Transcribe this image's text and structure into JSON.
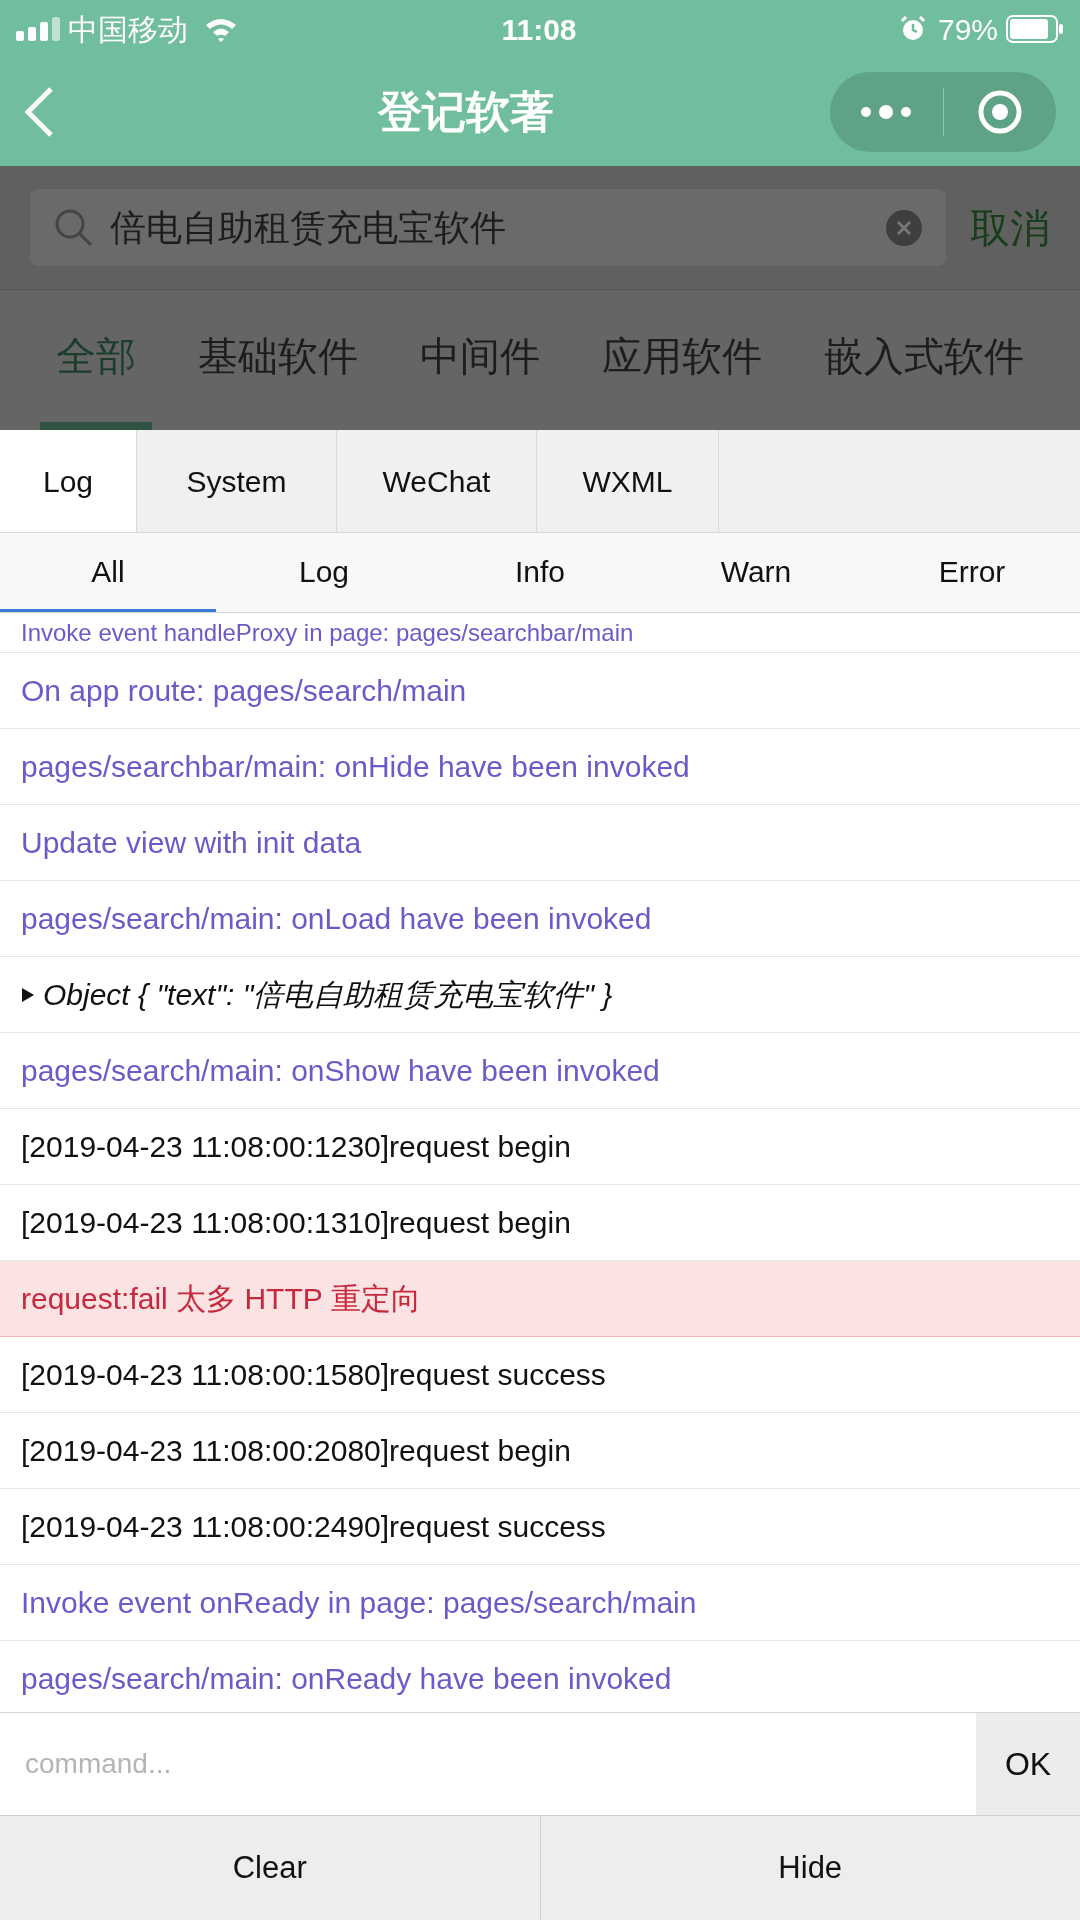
{
  "status_bar": {
    "carrier": "中国移动",
    "time": "11:08",
    "battery": "79%"
  },
  "nav_bar": {
    "title": "登记软著"
  },
  "search": {
    "value": "倍电自助租赁充电宝软件",
    "cancel": "取消"
  },
  "categories": [
    {
      "label": "全部",
      "selected": true
    },
    {
      "label": "基础软件",
      "selected": false
    },
    {
      "label": "中间件",
      "selected": false
    },
    {
      "label": "应用软件",
      "selected": false
    },
    {
      "label": "嵌入式软件",
      "selected": false
    }
  ],
  "console": {
    "tabs": [
      {
        "label": "Log",
        "selected": true
      },
      {
        "label": "System",
        "selected": false
      },
      {
        "label": "WeChat",
        "selected": false
      },
      {
        "label": "WXML",
        "selected": false
      }
    ],
    "filters": [
      {
        "label": "All",
        "selected": true
      },
      {
        "label": "Log",
        "selected": false
      },
      {
        "label": "Info",
        "selected": false
      },
      {
        "label": "Warn",
        "selected": false
      },
      {
        "label": "Error",
        "selected": false
      }
    ],
    "logs": [
      {
        "kind": "system",
        "text": "Invoke event handleProxy in page: pages/searchbar/main"
      },
      {
        "kind": "system",
        "text": "On app route: pages/search/main"
      },
      {
        "kind": "system",
        "text": "pages/searchbar/main: onHide have been invoked"
      },
      {
        "kind": "system",
        "text": "Update view with init data"
      },
      {
        "kind": "system",
        "text": "pages/search/main: onLoad have been invoked"
      },
      {
        "kind": "object",
        "expanded": false,
        "text": "Object { \"text\": \"倍电自助租赁充电宝软件\" }"
      },
      {
        "kind": "system",
        "text": "pages/search/main: onShow have been invoked"
      },
      {
        "kind": "log",
        "text": "[2019-04-23 11:08:00:1230]request begin"
      },
      {
        "kind": "log",
        "text": "[2019-04-23 11:08:00:1310]request begin"
      },
      {
        "kind": "error",
        "text": "request:fail 太多 HTTP 重定向"
      },
      {
        "kind": "log",
        "text": "[2019-04-23 11:08:00:1580]request success"
      },
      {
        "kind": "log",
        "text": "[2019-04-23 11:08:00:2080]request begin"
      },
      {
        "kind": "log",
        "text": "[2019-04-23 11:08:00:2490]request success"
      },
      {
        "kind": "system",
        "text": "Invoke event onReady in page: pages/search/main"
      },
      {
        "kind": "system",
        "text": "pages/search/main: onReady have been invoked"
      }
    ],
    "command": {
      "placeholder": "command...",
      "ok": "OK"
    },
    "buttons": [
      "Clear",
      "Hide"
    ]
  }
}
